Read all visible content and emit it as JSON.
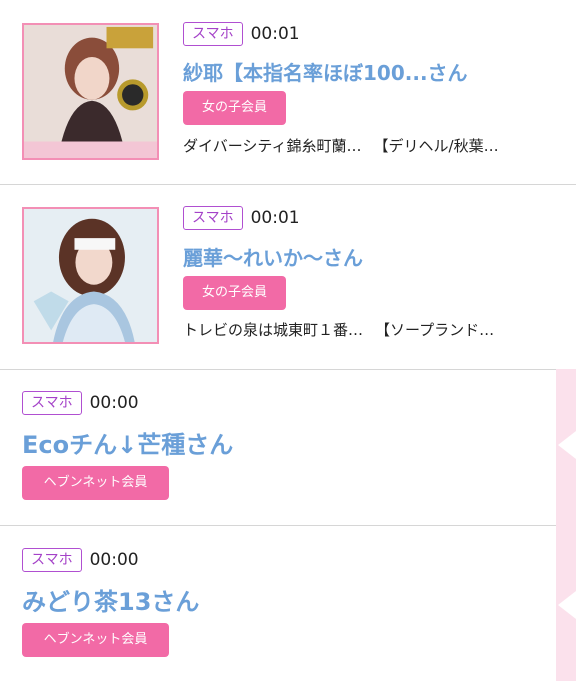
{
  "feed": {
    "items": [
      {
        "device": "スマホ",
        "time": "00:01",
        "name": "紗耶【本指名率ほぼ100...さん",
        "member": "女の子会員",
        "shops": [
          "ダイバーシティ錦糸町蘭…",
          "【デリヘル/秋葉…"
        ]
      },
      {
        "device": "スマホ",
        "time": "00:01",
        "name": "麗華～れいか～さん",
        "member": "女の子会員",
        "shops": [
          "トレビの泉は城東町１番…",
          "【ソープランド…"
        ]
      },
      {
        "device": "スマホ",
        "time": "00:00",
        "name": "Ecoチん↓芒種さん",
        "member": "ヘブンネット会員"
      },
      {
        "device": "スマホ",
        "time": "00:00",
        "name": "みどり茶13さん",
        "member": "ヘブンネット会員"
      }
    ]
  },
  "colors": {
    "device_badge": "#a442c8",
    "name": "#6a9fd8",
    "member_badge": "#f26aa6",
    "thumb_border": "#f38fb5",
    "side_strip": "#fbe1ec"
  }
}
